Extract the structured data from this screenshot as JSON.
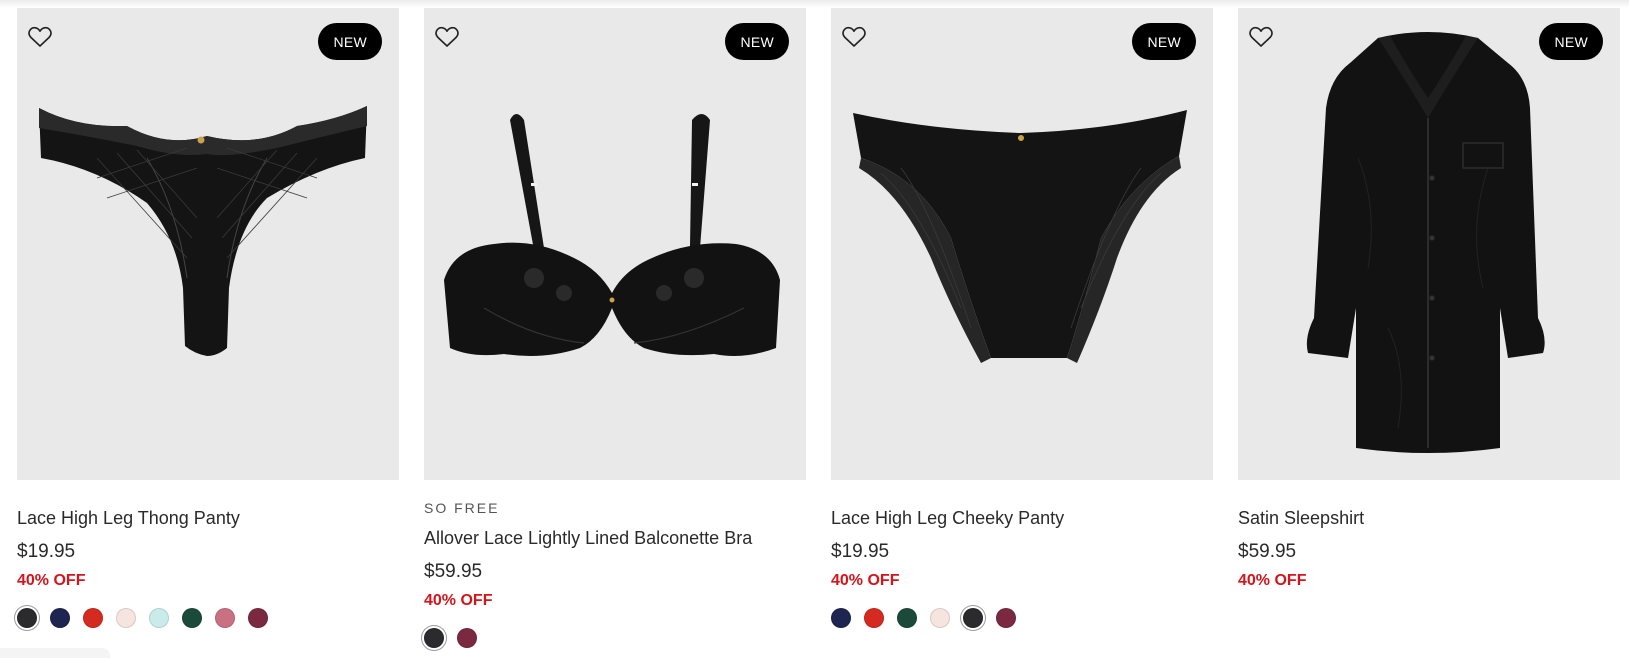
{
  "products": [
    {
      "badge": "NEW",
      "brand": "",
      "name": "Lace High Leg Thong Panty",
      "price": "$19.95",
      "discount": "40% OFF",
      "swatches": [
        "#2b2b2e",
        "#1d2550",
        "#d42a1f",
        "#f6e4de",
        "#c9ecea",
        "#1b4a3a",
        "#c97082",
        "#7a2940"
      ],
      "selected_swatch": 0,
      "image_icon": "thong-panty-image"
    },
    {
      "badge": "NEW",
      "brand": "SO FREE",
      "name": "Allover Lace Lightly Lined Balconette Bra",
      "price": "$59.95",
      "discount": "40% OFF",
      "swatches": [
        "#2b2b2e",
        "#7a2940"
      ],
      "selected_swatch": 0,
      "image_icon": "balconette-bra-image"
    },
    {
      "badge": "NEW",
      "brand": "",
      "name": "Lace High Leg Cheeky Panty",
      "price": "$19.95",
      "discount": "40% OFF",
      "swatches": [
        "#1d2550",
        "#d42a1f",
        "#1b4a3a",
        "#f6e4de",
        "#2b2b2e",
        "#7a2940"
      ],
      "selected_swatch": 4,
      "image_icon": "cheeky-panty-image"
    },
    {
      "badge": "NEW",
      "brand": "",
      "name": "Satin Sleepshirt",
      "price": "$59.95",
      "discount": "40% OFF",
      "swatches": [],
      "selected_swatch": -1,
      "image_icon": "sleepshirt-image"
    }
  ],
  "colors": {
    "discount": "#d4151b",
    "badge_bg": "#000000",
    "image_bg": "#e9e9e9"
  }
}
